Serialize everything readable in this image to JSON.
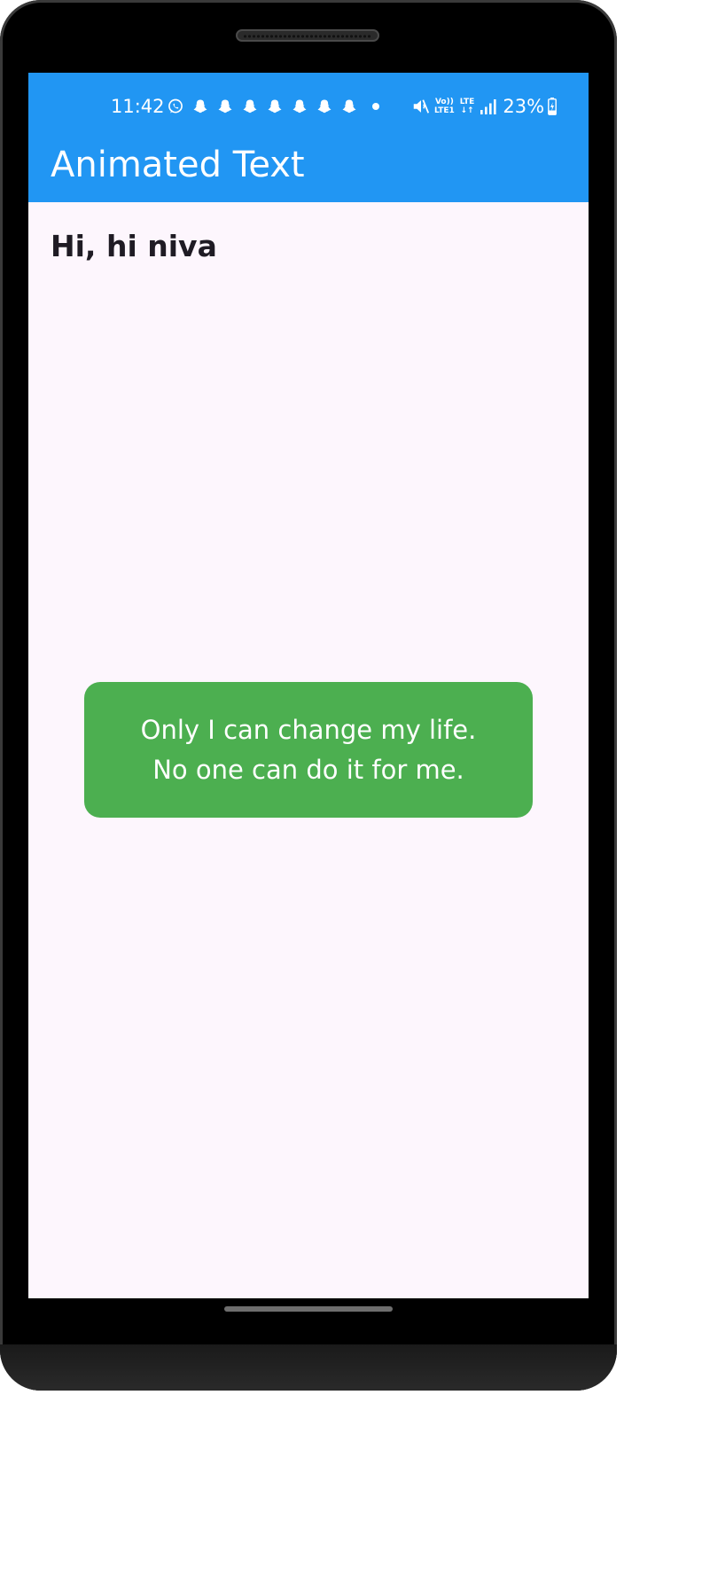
{
  "status_bar": {
    "time": "11:42",
    "notification_icons": [
      "whatsapp-icon",
      "snapchat-icon",
      "snapchat-icon",
      "snapchat-icon",
      "snapchat-icon",
      "snapchat-icon",
      "snapchat-icon",
      "snapchat-icon"
    ],
    "volte_top": "Vo))",
    "volte_bottom": "LTE1",
    "lte_top": "LTE",
    "lte_bottom": "↓↑",
    "battery_percent": "23%",
    "bar_color": "#2196f3"
  },
  "app_bar": {
    "title": "Animated Text",
    "color": "#2196f3"
  },
  "content": {
    "greeting": "Hi, hi niva",
    "quote": "Only I can change my life. No one can do it for me.",
    "quote_card_color": "#4caf50",
    "background_color": "#fdf6fd"
  }
}
